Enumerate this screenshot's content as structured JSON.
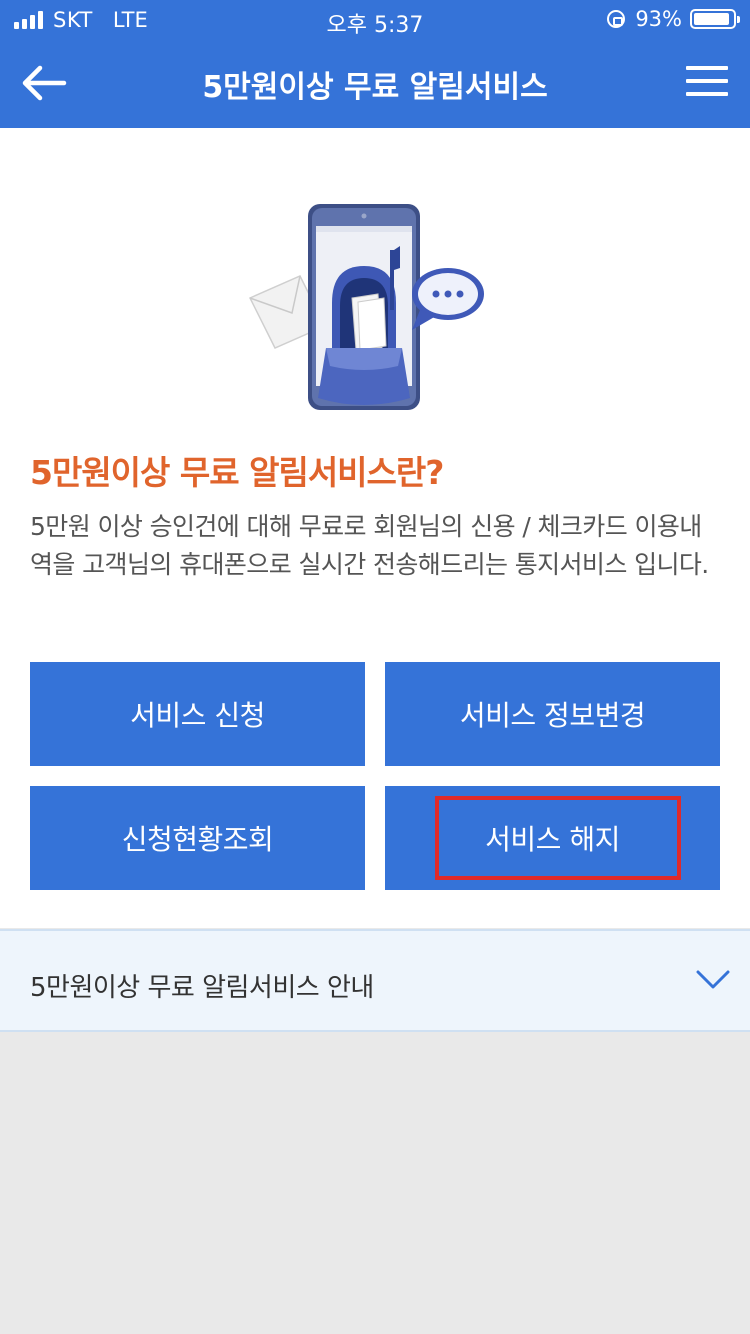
{
  "status_bar": {
    "carrier": "SKT",
    "network": "LTE",
    "time": "오후 5:37",
    "battery_percent": "93%",
    "battery_level": 0.93
  },
  "nav": {
    "title": "5만원이상 무료 알림서비스",
    "back_icon": "back-arrow-icon",
    "menu_icon": "hamburger-menu-icon"
  },
  "intro": {
    "title": "5만원이상 무료 알림서비스란?",
    "description": "5만원 이상 승인건에 대해 무료로 회원님의 신용 / 체크카드 이용내역을 고객님의 휴대폰으로 실시간 전송해드리는 통지서비스 입니다."
  },
  "buttons": {
    "apply": "서비스 신청",
    "change_info": "서비스 정보변경",
    "status_inquiry": "신청현황조회",
    "cancel": "서비스 해지"
  },
  "accordion": {
    "label": "5만원이상 무료 알림서비스 안내",
    "icon": "chevron-down-icon"
  },
  "colors": {
    "primary": "#3573d8",
    "title_orange": "#e0642c",
    "highlight_red": "#e02a2a",
    "accordion_bg": "#eef5fc"
  }
}
